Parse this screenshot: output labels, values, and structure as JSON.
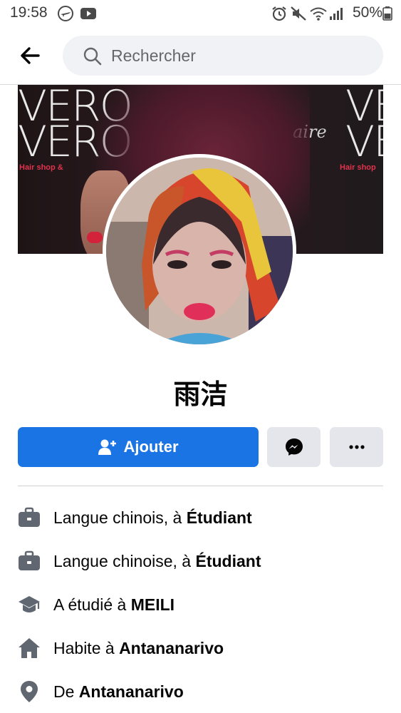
{
  "status_bar": {
    "time": "19:58",
    "battery": "50%",
    "left_icons": [
      "airplane-notification-icon",
      "youtube-icon"
    ],
    "right_icons": [
      "alarm-icon",
      "mute-icon",
      "wifi-icon",
      "signal-icon",
      "battery-icon"
    ]
  },
  "header": {
    "search_placeholder": "Rechercher"
  },
  "cover": {
    "text_left_1": "VERO",
    "text_left_2": "VERO",
    "text_right_1": "VER",
    "text_right_2": "VER",
    "sub_left": "Hair shop &",
    "sub_right": "Hair shop",
    "script_text": "aire"
  },
  "profile": {
    "name": "雨洁"
  },
  "actions": {
    "add_label": "Ajouter"
  },
  "details": [
    {
      "icon": "briefcase-icon",
      "prefix": "Langue chinois, à ",
      "bold": "Étudiant"
    },
    {
      "icon": "briefcase-icon",
      "prefix": "Langue chinoise, à ",
      "bold": "Étudiant"
    },
    {
      "icon": "graduation-cap-icon",
      "prefix": "A étudié à ",
      "bold": "MEILI"
    },
    {
      "icon": "home-icon",
      "prefix": "Habite à ",
      "bold": "Antananarivo"
    },
    {
      "icon": "location-pin-icon",
      "prefix": "De ",
      "bold": "Antananarivo"
    }
  ],
  "colors": {
    "primary": "#1b74e4",
    "secondary_button": "#e4e6eb",
    "search_bg": "#f0f2f5",
    "icon_gray": "#606770"
  }
}
